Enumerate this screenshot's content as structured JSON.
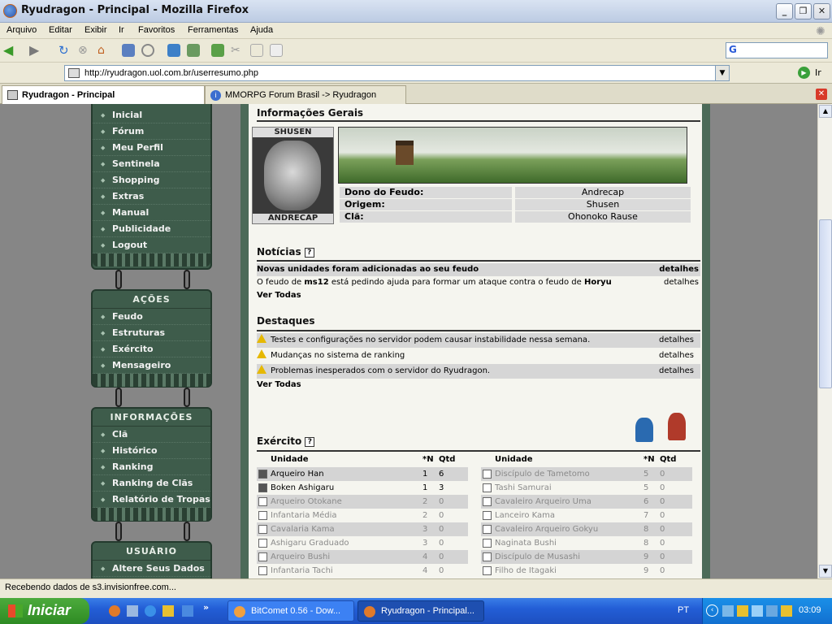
{
  "window": {
    "title": "Ryudragon - Principal - Mozilla Firefox"
  },
  "menu": [
    "Arquivo",
    "Editar",
    "Exibir",
    "Ir",
    "Favoritos",
    "Ferramentas",
    "Ajuda"
  ],
  "address": {
    "url": "http://ryudragon.uol.com.br/userresumo.php",
    "go_label": "Ir"
  },
  "tabs": [
    {
      "label": "Ryudragon - Principal",
      "active": true
    },
    {
      "label": "MMORPG Forum Brasil -> Ryudragon",
      "active": false
    }
  ],
  "sidebar": {
    "main_items": [
      "Inicial",
      "Fórum",
      "Meu Perfil",
      "Sentinela",
      "Shopping",
      "Extras",
      "Manual",
      "Publicidade",
      "Logout"
    ],
    "acoes": {
      "header": "AÇÕES",
      "items": [
        "Feudo",
        "Estruturas",
        "Exército",
        "Mensageiro"
      ]
    },
    "informacoes": {
      "header": "INFORMAÇÕES",
      "items": [
        "Clã",
        "Histórico",
        "Ranking",
        "Ranking de Clãs",
        "Relatório de Tropas"
      ]
    },
    "usuario": {
      "header": "USUÁRIO",
      "items": [
        "Altere Seus Dados"
      ]
    }
  },
  "main": {
    "geral": {
      "title": "Informações Gerais",
      "avatar_top": "SHUSEN",
      "avatar_bottom": "ANDRECAP",
      "rows": [
        {
          "label": "Dono do Feudo:",
          "value": "Andrecap"
        },
        {
          "label": "Origem:",
          "value": "Shusen"
        },
        {
          "label": "Clã:",
          "value": "Ohonoko Rause"
        }
      ]
    },
    "noticias": {
      "title": "Notícias",
      "help": "?",
      "items": [
        {
          "text": "Novas unidades foram adicionadas ao seu feudo",
          "link": "detalhes"
        },
        {
          "text_a": "O feudo de ",
          "bold_a": "ms12",
          "text_b": " está pedindo ajuda para formar um ataque contra o feudo de ",
          "bold_b": "Horyu",
          "link": "detalhes"
        }
      ],
      "see_all": "Ver Todas"
    },
    "destaques": {
      "title": "Destaques",
      "items": [
        {
          "text": "Testes e configurações no servidor podem causar instabilidade nessa semana.",
          "link": "detalhes"
        },
        {
          "text": "Mudanças no sistema de ranking",
          "link": "detalhes"
        },
        {
          "text": "Problemas inesperados com o servidor do Ryudragon.",
          "link": "detalhes"
        }
      ],
      "see_all": "Ver Todas"
    },
    "exercito": {
      "title": "Exército",
      "help": "?",
      "headers": {
        "unit": "Unidade",
        "level": "*N",
        "qty": "Qtd"
      },
      "left": [
        {
          "name": "Arqueiro Han",
          "n": "1",
          "q": "6",
          "owned": true
        },
        {
          "name": "Boken Ashigaru",
          "n": "1",
          "q": "3",
          "owned": true
        },
        {
          "name": "Arqueiro Otokane",
          "n": "2",
          "q": "0",
          "owned": false
        },
        {
          "name": "Infantaria Média",
          "n": "2",
          "q": "0",
          "owned": false
        },
        {
          "name": "Cavalaria Kama",
          "n": "3",
          "q": "0",
          "owned": false
        },
        {
          "name": "Ashigaru Graduado",
          "n": "3",
          "q": "0",
          "owned": false
        },
        {
          "name": "Arqueiro Bushi",
          "n": "4",
          "q": "0",
          "owned": false
        },
        {
          "name": "Infantaria Tachi",
          "n": "4",
          "q": "0",
          "owned": false
        }
      ],
      "right": [
        {
          "name": "Discípulo de Tametomo",
          "n": "5",
          "q": "0",
          "owned": false
        },
        {
          "name": "Tashi Samurai",
          "n": "5",
          "q": "0",
          "owned": false
        },
        {
          "name": "Cavaleiro Arqueiro Uma",
          "n": "6",
          "q": "0",
          "owned": false
        },
        {
          "name": "Lanceiro Kama",
          "n": "7",
          "q": "0",
          "owned": false
        },
        {
          "name": "Cavaleiro Arqueiro Gokyu",
          "n": "8",
          "q": "0",
          "owned": false
        },
        {
          "name": "Naginata Bushi",
          "n": "8",
          "q": "0",
          "owned": false
        },
        {
          "name": "Discípulo de Musashi",
          "n": "9",
          "q": "0",
          "owned": false
        },
        {
          "name": "Filho de Itagaki",
          "n": "9",
          "q": "0",
          "owned": false
        }
      ]
    }
  },
  "status": {
    "text": "Recebendo dados de s3.invisionfree.com..."
  },
  "taskbar": {
    "start": "Iniciar",
    "tasks": [
      "BitComet 0.56 - Dow...",
      "Ryudragon - Principal..."
    ],
    "lang": "PT",
    "clock": "03:09"
  },
  "colors": {
    "sidebar_green": "#3e5c4b",
    "panel_border": "#4c6a58",
    "taskbar_blue": "#235ed6",
    "start_green": "#2e8b23"
  }
}
